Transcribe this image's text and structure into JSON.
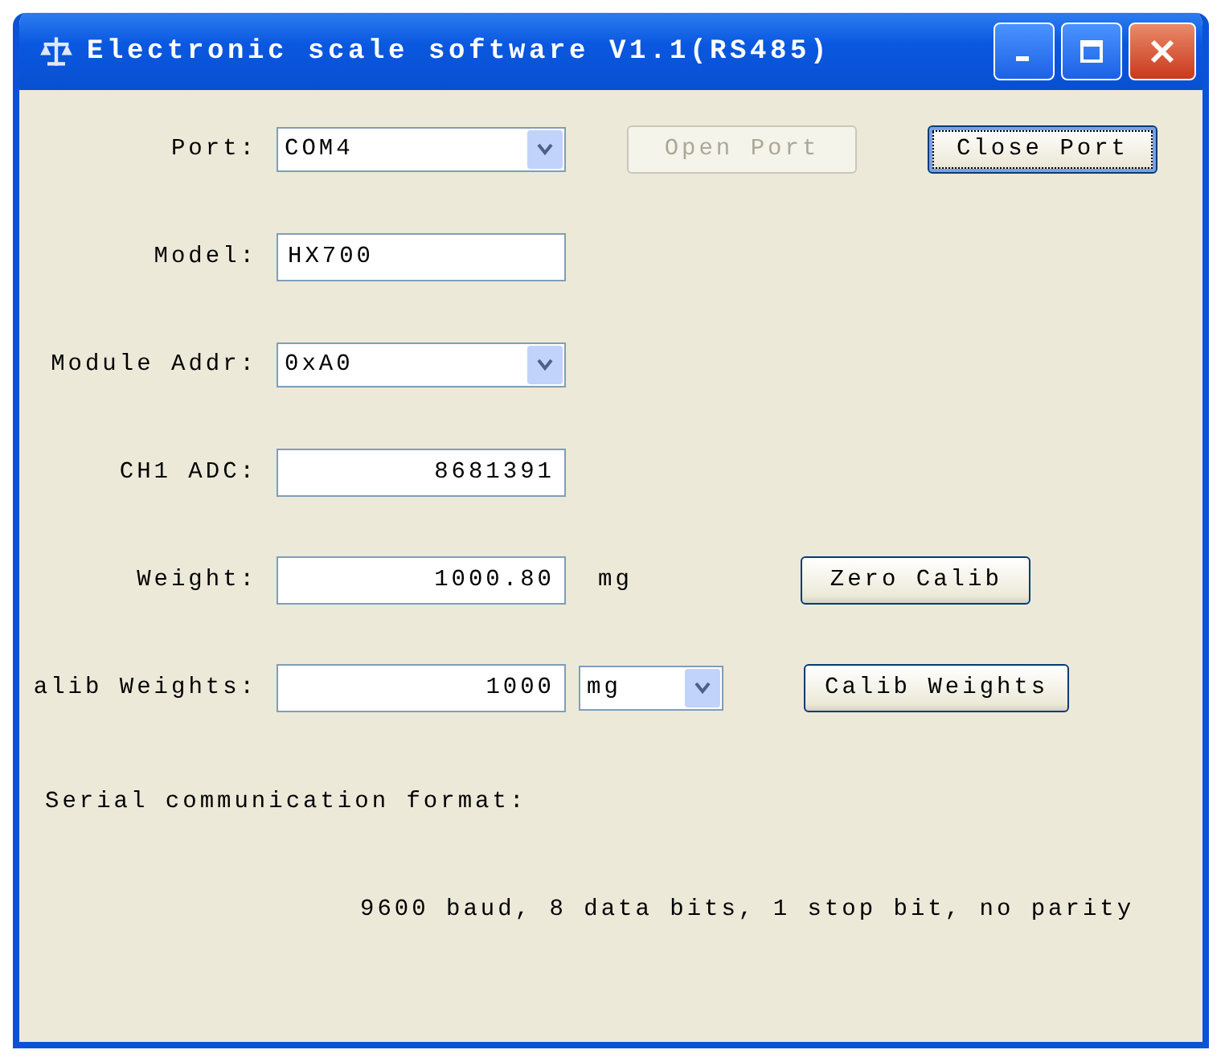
{
  "window": {
    "title": "Electronic scale software V1.1(RS485)"
  },
  "rows": [
    {
      "label": "Port:",
      "field": {
        "kind": "combo",
        "value": "COM4"
      },
      "buttons": [
        {
          "label": "Open Port",
          "disabled": true,
          "focused": false
        },
        {
          "label": "Close Port",
          "disabled": false,
          "focused": true
        }
      ]
    },
    {
      "label": "Model:",
      "field": {
        "kind": "text",
        "value": "HX700"
      }
    },
    {
      "label": "Module Addr:",
      "field": {
        "kind": "combo",
        "value": "0xA0"
      }
    },
    {
      "label": "CH1 ADC:",
      "field": {
        "kind": "number",
        "value": "8681391"
      }
    },
    {
      "label": "Weight:",
      "field": {
        "kind": "number",
        "value": "1000.80"
      },
      "unit": {
        "kind": "text",
        "value": "mg"
      },
      "buttons": [
        {
          "label": "Zero Calib",
          "disabled": false,
          "focused": false
        }
      ]
    },
    {
      "label": "alib Weights:",
      "field": {
        "kind": "number",
        "value": "1000"
      },
      "unit": {
        "kind": "combo",
        "value": "mg"
      },
      "buttons": [
        {
          "label": "Calib Weights",
          "disabled": false,
          "focused": false
        }
      ]
    }
  ],
  "format": {
    "heading": "Serial communication format:",
    "details": "9600 baud, 8 data bits, 1 stop bit, no parity"
  }
}
